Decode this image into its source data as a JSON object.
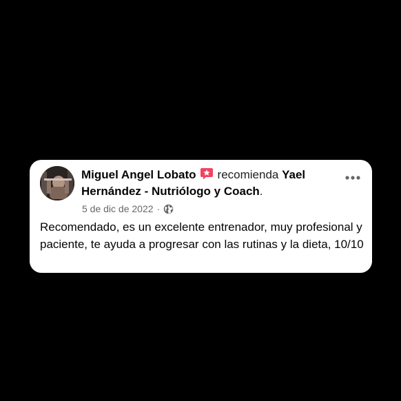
{
  "review": {
    "author_name": "Miguel Angel Lobato",
    "recommend_text": "recomienda",
    "page_name": "Yael Hernández - Nutriólogo y Coach",
    "page_suffix": ".",
    "date": "5 de dic de 2022",
    "separator": "·",
    "privacy_icon": "globe-icon",
    "badge_icon": "star-badge-icon",
    "badge_color": "#f3425f",
    "more_icon": "more-options-icon",
    "body": "Recomendado, es un excelente entrenador, muy profesional y paciente, te ayuda a progresar con las rutinas y la dieta, 10/10"
  }
}
